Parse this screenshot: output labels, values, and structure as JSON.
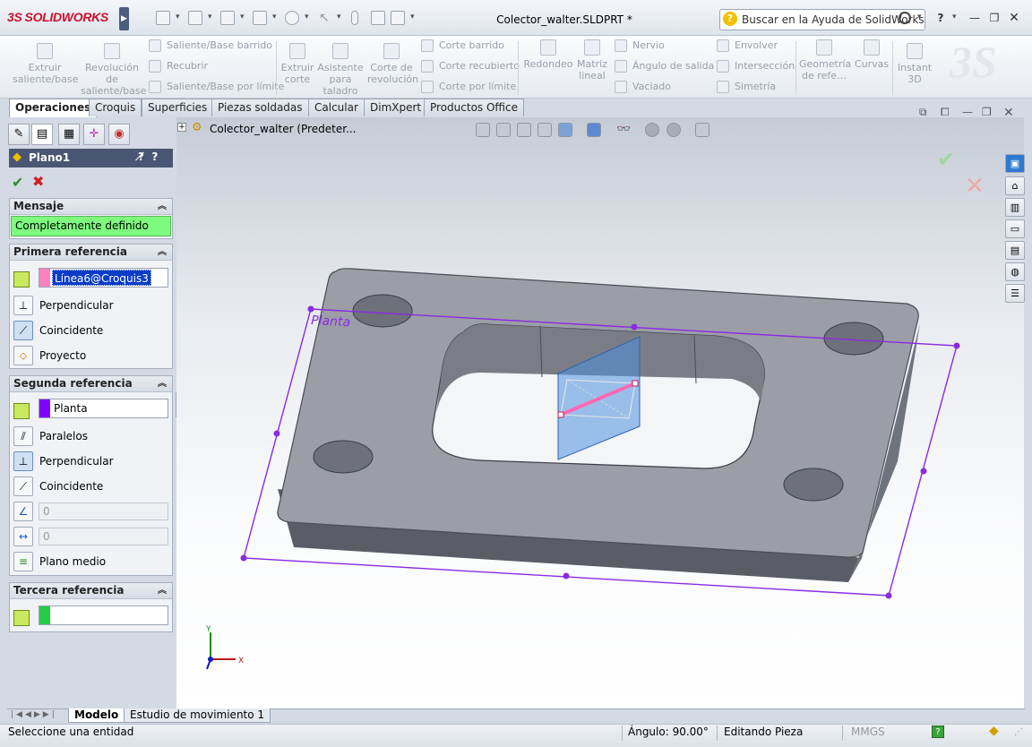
{
  "app": {
    "logo_brand": "3S",
    "logo_name": "SOLIDWORKS",
    "document_title": "Colector_walter.SLDPRT *",
    "help_search_placeholder": "Buscar en la Ayuda de SolidWorks",
    "help_icon": "?"
  },
  "commands": {
    "extrude_boss": "Extruir saliente/base",
    "revolve_boss": "Revolución de saliente/base",
    "swept_boss": "Saliente/Base barrido",
    "loft_boss": "Recubrir",
    "boundary_boss": "Saliente/Base por límite",
    "extruded_cut": "Extruir corte",
    "hole_wizard": "Asistente para taladro",
    "revolved_cut": "Corte de revolución",
    "swept_cut": "Corte barrido",
    "lofted_cut": "Corte recubierto",
    "boundary_cut": "Corte por límite",
    "fillet": "Redondeo",
    "linear_pattern": "Matriz lineal",
    "rib": "Nervio",
    "draft": "Ángulo de salida",
    "shell": "Vaciado",
    "wrap": "Envolver",
    "intersect": "Intersección",
    "mirror": "Simetría",
    "reference_geometry": "Geometría de refe…",
    "curves": "Curvas",
    "instant3d": "Instant 3D"
  },
  "tabs": [
    "Operaciones",
    "Croquis",
    "Superficies",
    "Piezas soldadas",
    "Calcular",
    "DimXpert",
    "Productos Office"
  ],
  "tree": {
    "root_label": "Colector_walter  (Predeter..."
  },
  "property_manager": {
    "title": "Plano1",
    "help": "?",
    "message_group": {
      "title": "Mensaje",
      "text": "Completamente definido"
    },
    "first_reference": {
      "title": "Primera referencia",
      "selection": "Línea6@Croquis3",
      "selection_color": "#ff80c0",
      "options": [
        "Perpendicular",
        "Coincidente",
        "Proyecto"
      ]
    },
    "second_reference": {
      "title": "Segunda referencia",
      "selection": "Planta",
      "selection_color": "#8000ff",
      "options": [
        "Paralelos",
        "Perpendicular",
        "Coincidente"
      ],
      "angle_value": "0",
      "distance_value": "0",
      "midplane": "Plano medio"
    },
    "third_reference": {
      "title": "Tercera referencia",
      "selection": "",
      "selection_color": "#22cc44"
    }
  },
  "viewport": {
    "plane_label": "Planta",
    "triad_x": "X",
    "triad_y": "Y"
  },
  "bottom_tabs": [
    "Modelo",
    "Estudio de movimiento 1"
  ],
  "status": {
    "prompt": "Seleccione una entidad",
    "angle": "Ángulo: 90.00°",
    "mode": "Editando Pieza",
    "units": "MMGS"
  },
  "colors": {
    "plane_outline": "#8a2be2",
    "sketch_line": "#ff69b4",
    "message_ok": "#7efa7e"
  }
}
